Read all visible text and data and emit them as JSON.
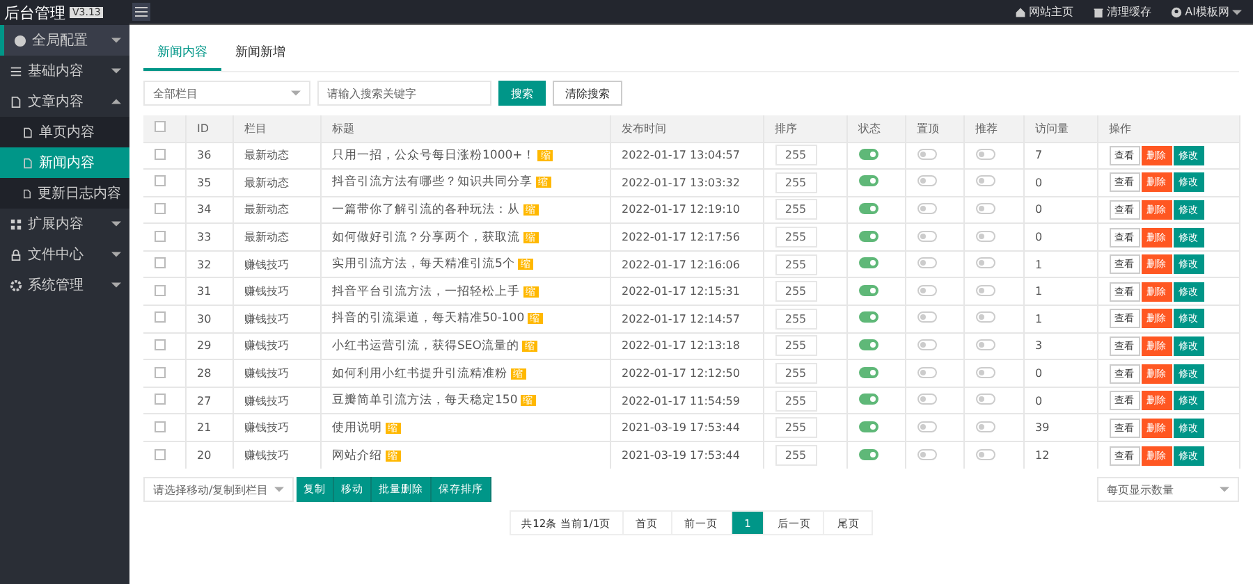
{
  "brand": {
    "title": "后台管理",
    "version": "V3.13"
  },
  "header": {
    "links": [
      {
        "kind": "home",
        "label": "网站主页"
      },
      {
        "kind": "trash",
        "label": "清理缓存"
      },
      {
        "kind": "user",
        "label": "AI模板网"
      }
    ]
  },
  "sidebar": {
    "items": [
      {
        "kind": "globe",
        "label": "全局配置",
        "selected": true,
        "expanded": false
      },
      {
        "kind": "list",
        "label": "基础内容",
        "selected": false,
        "expanded": false
      },
      {
        "kind": "doc",
        "label": "文章内容",
        "selected": false,
        "expanded": true,
        "children": [
          {
            "label": "单页内容",
            "selected": false
          },
          {
            "label": "新闻内容",
            "selected": true
          },
          {
            "label": "更新日志内容",
            "selected": false
          }
        ]
      },
      {
        "kind": "grid",
        "label": "扩展内容",
        "selected": false,
        "expanded": false
      },
      {
        "kind": "lock",
        "label": "文件中心",
        "selected": false,
        "expanded": false
      },
      {
        "kind": "gear",
        "label": "系统管理",
        "selected": false,
        "expanded": false
      }
    ]
  },
  "tabs": [
    {
      "label": "新闻内容",
      "selected": true
    },
    {
      "label": "新闻新增",
      "selected": false
    }
  ],
  "filter": {
    "category": "全部栏目",
    "search_placeholder": "请输入搜索关键字",
    "search_button": "搜索",
    "clear_button": "清除搜索"
  },
  "table": {
    "select_all": false,
    "columns": [
      "ID",
      "栏目",
      "标题",
      "发布时间",
      "排序",
      "状态",
      "置顶",
      "推荐",
      "访问量",
      "操作"
    ],
    "rows": [
      {
        "id": "36",
        "category": "最新动态",
        "title": "只用一招，公众号每日涨粉1000+！",
        "badge": "缩",
        "time": "2022-01-17 13:04:57",
        "sort": "255",
        "status": true,
        "top": false,
        "recommend": false,
        "visits": "7",
        "checked": false,
        "actions": [
          {
            "kind": "view",
            "label": "查看"
          },
          {
            "kind": "delete",
            "label": "删除"
          },
          {
            "kind": "edit",
            "label": "修改"
          }
        ]
      },
      {
        "id": "35",
        "category": "最新动态",
        "title": "抖音引流方法有哪些？知识共同分享",
        "badge": "缩",
        "time": "2022-01-17 13:03:32",
        "sort": "255",
        "status": true,
        "top": false,
        "recommend": false,
        "visits": "0",
        "checked": false,
        "actions": [
          {
            "kind": "view",
            "label": "查看"
          },
          {
            "kind": "delete",
            "label": "删除"
          },
          {
            "kind": "edit",
            "label": "修改"
          }
        ]
      },
      {
        "id": "34",
        "category": "最新动态",
        "title": "一篇带你了解引流的各种玩法：从",
        "badge": "缩",
        "time": "2022-01-17 12:19:10",
        "sort": "255",
        "status": true,
        "top": false,
        "recommend": false,
        "visits": "0",
        "checked": false,
        "actions": [
          {
            "kind": "view",
            "label": "查看"
          },
          {
            "kind": "delete",
            "label": "删除"
          },
          {
            "kind": "edit",
            "label": "修改"
          }
        ]
      },
      {
        "id": "33",
        "category": "最新动态",
        "title": "如何做好引流？分享两个，获取流",
        "badge": "缩",
        "time": "2022-01-17 12:17:56",
        "sort": "255",
        "status": true,
        "top": false,
        "recommend": false,
        "visits": "0",
        "checked": false,
        "actions": [
          {
            "kind": "view",
            "label": "查看"
          },
          {
            "kind": "delete",
            "label": "删除"
          },
          {
            "kind": "edit",
            "label": "修改"
          }
        ]
      },
      {
        "id": "32",
        "category": "赚钱技巧",
        "title": "实用引流方法，每天精准引流5个",
        "badge": "缩",
        "time": "2022-01-17 12:16:06",
        "sort": "255",
        "status": true,
        "top": false,
        "recommend": false,
        "visits": "1",
        "checked": false,
        "actions": [
          {
            "kind": "view",
            "label": "查看"
          },
          {
            "kind": "delete",
            "label": "删除"
          },
          {
            "kind": "edit",
            "label": "修改"
          }
        ]
      },
      {
        "id": "31",
        "category": "赚钱技巧",
        "title": "抖音平台引流方法，一招轻松上手",
        "badge": "缩",
        "time": "2022-01-17 12:15:31",
        "sort": "255",
        "status": true,
        "top": false,
        "recommend": false,
        "visits": "1",
        "checked": false,
        "actions": [
          {
            "kind": "view",
            "label": "查看"
          },
          {
            "kind": "delete",
            "label": "删除"
          },
          {
            "kind": "edit",
            "label": "修改"
          }
        ]
      },
      {
        "id": "30",
        "category": "赚钱技巧",
        "title": "抖音的引流渠道，每天精准50-100",
        "badge": "缩",
        "time": "2022-01-17 12:14:57",
        "sort": "255",
        "status": true,
        "top": false,
        "recommend": false,
        "visits": "1",
        "checked": false,
        "actions": [
          {
            "kind": "view",
            "label": "查看"
          },
          {
            "kind": "delete",
            "label": "删除"
          },
          {
            "kind": "edit",
            "label": "修改"
          }
        ]
      },
      {
        "id": "29",
        "category": "赚钱技巧",
        "title": "小红书运营引流，获得SEO流量的",
        "badge": "缩",
        "time": "2022-01-17 12:13:18",
        "sort": "255",
        "status": true,
        "top": false,
        "recommend": false,
        "visits": "3",
        "checked": false,
        "actions": [
          {
            "kind": "view",
            "label": "查看"
          },
          {
            "kind": "delete",
            "label": "删除"
          },
          {
            "kind": "edit",
            "label": "修改"
          }
        ]
      },
      {
        "id": "28",
        "category": "赚钱技巧",
        "title": "如何利用小红书提升引流精准粉",
        "badge": "缩",
        "time": "2022-01-17 12:12:50",
        "sort": "255",
        "status": true,
        "top": false,
        "recommend": false,
        "visits": "0",
        "checked": false,
        "actions": [
          {
            "kind": "view",
            "label": "查看"
          },
          {
            "kind": "delete",
            "label": "删除"
          },
          {
            "kind": "edit",
            "label": "修改"
          }
        ]
      },
      {
        "id": "27",
        "category": "赚钱技巧",
        "title": "豆瓣简单引流方法，每天稳定150",
        "badge": "缩",
        "time": "2022-01-17 11:54:59",
        "sort": "255",
        "status": true,
        "top": false,
        "recommend": false,
        "visits": "0",
        "checked": false,
        "actions": [
          {
            "kind": "view",
            "label": "查看"
          },
          {
            "kind": "delete",
            "label": "删除"
          },
          {
            "kind": "edit",
            "label": "修改"
          }
        ]
      },
      {
        "id": "21",
        "category": "赚钱技巧",
        "title": "使用说明",
        "badge": "缩",
        "time": "2021-03-19 17:53:44",
        "sort": "255",
        "status": true,
        "top": false,
        "recommend": false,
        "visits": "39",
        "checked": false,
        "actions": [
          {
            "kind": "view",
            "label": "查看"
          },
          {
            "kind": "delete",
            "label": "删除"
          },
          {
            "kind": "edit",
            "label": "修改"
          }
        ]
      },
      {
        "id": "20",
        "category": "赚钱技巧",
        "title": "网站介绍",
        "badge": "缩",
        "time": "2021-03-19 17:53:44",
        "sort": "255",
        "status": true,
        "top": false,
        "recommend": false,
        "visits": "12",
        "checked": false,
        "actions": [
          {
            "kind": "view",
            "label": "查看"
          },
          {
            "kind": "delete",
            "label": "删除"
          },
          {
            "kind": "edit",
            "label": "修改"
          }
        ]
      }
    ]
  },
  "bulk": {
    "target_placeholder": "请选择移动/复制到栏目",
    "buttons": [
      "复制",
      "移动",
      "批量删除",
      "保存排序"
    ],
    "page_size_placeholder": "每页显示数量"
  },
  "pagination": {
    "summary": "共12条 当前1/1页",
    "items": [
      {
        "label": "首页",
        "selected": false
      },
      {
        "label": "前一页",
        "selected": false
      },
      {
        "label": "1",
        "selected": true
      },
      {
        "label": "后一页",
        "selected": false
      },
      {
        "label": "尾页",
        "selected": false
      }
    ]
  }
}
